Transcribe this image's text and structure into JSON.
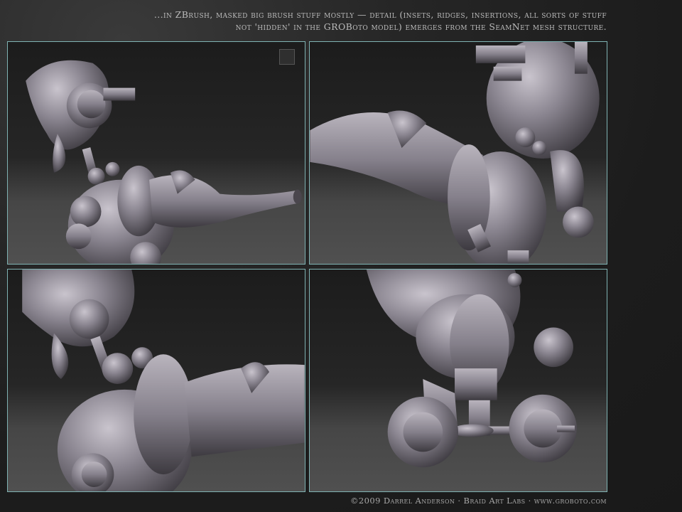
{
  "caption": {
    "line1": "...in ZBrush, masked big brush stuff mostly — detail (insets, ridges, insertions, all sorts of stuff",
    "line2": "not 'hidden' in the GROBoto model) emerges from the SeamNet mesh structure."
  },
  "footer": {
    "credit": "©2009 Darrel Anderson · Braid Art Labs · www.groboto.com"
  },
  "panels": [
    {
      "view": "top-left"
    },
    {
      "view": "top-right"
    },
    {
      "view": "bottom-left"
    },
    {
      "view": "bottom-right"
    }
  ],
  "colors": {
    "frame": "#7fb3b3",
    "model": "#8a8590",
    "text": "#bcbcbc"
  }
}
